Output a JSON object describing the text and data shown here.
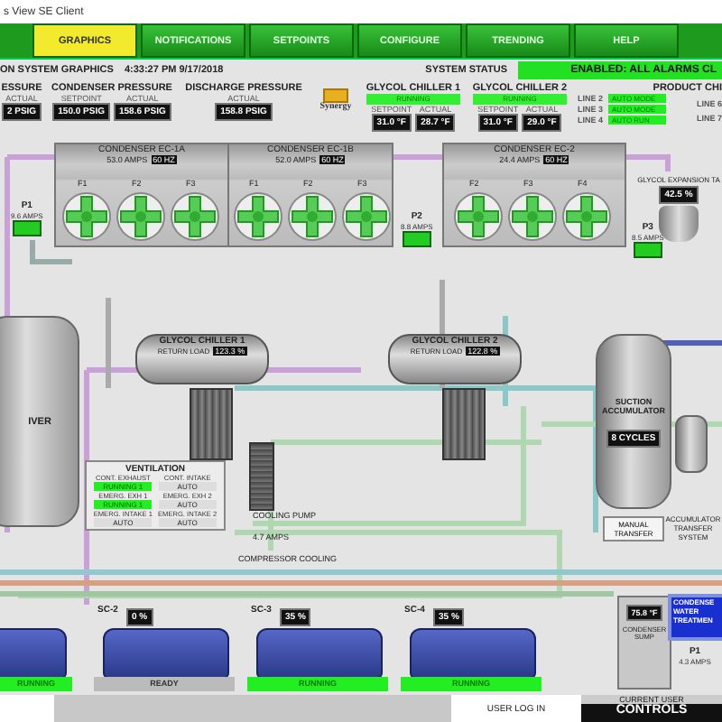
{
  "window": {
    "title": "s View SE Client"
  },
  "tabs": [
    {
      "label": "GRAPHICS",
      "selected": true
    },
    {
      "label": "NOTIFICATIONS",
      "selected": false
    },
    {
      "label": "SETPOINTS",
      "selected": false
    },
    {
      "label": "CONFIGURE",
      "selected": false
    },
    {
      "label": "TRENDING",
      "selected": false
    },
    {
      "label": "HELP",
      "selected": false
    }
  ],
  "header": {
    "title": "ON SYSTEM GRAPHICS",
    "datetime": "4:33:27 PM 9/17/2018",
    "status_label": "SYSTEM STATUS",
    "status": "ENABLED: ALL ALARMS CL"
  },
  "pressure_panels": [
    {
      "title": "ESSURE",
      "fields": [
        {
          "label": "ACTUAL",
          "value": "2 PSIG"
        }
      ]
    },
    {
      "title": "CONDENSER PRESSURE",
      "fields": [
        {
          "label": "SETPOINT",
          "value": "150.0 PSIG"
        },
        {
          "label": "ACTUAL",
          "value": "158.6 PSIG"
        }
      ]
    },
    {
      "title": "DISCHARGE PRESSURE",
      "fields": [
        {
          "label": "ACTUAL",
          "value": "158.8 PSIG"
        }
      ]
    }
  ],
  "logo": {
    "text": "Synergy"
  },
  "chiller_panels": [
    {
      "title": "GLYCOL CHILLER 1",
      "status": "RUNNING",
      "fields": [
        {
          "label": "SETPOINT",
          "value": "31.0 °F"
        },
        {
          "label": "ACTUAL",
          "value": "28.7 °F"
        }
      ]
    },
    {
      "title": "GLYCOL CHILLER 2",
      "status": "RUNNING",
      "fields": [
        {
          "label": "SETPOINT",
          "value": "31.0 °F"
        },
        {
          "label": "ACTUAL",
          "value": "29.0 °F"
        }
      ]
    }
  ],
  "product_chillers": {
    "title": "PRODUCT CHI",
    "lines": [
      {
        "label": "LINE 2",
        "mode": "AUTO MODE"
      },
      {
        "label": "LINE 3",
        "mode": "AUTO MODE"
      },
      {
        "label": "LINE 4",
        "mode": "AUTO RUN"
      }
    ],
    "more": [
      "LINE 6",
      "LINE 7"
    ]
  },
  "condensers": [
    {
      "name": "CONDENSER EC-1A",
      "amps": "53.0 AMPS",
      "freq": "60 HZ",
      "fans": [
        "F1",
        "F2",
        "F3"
      ]
    },
    {
      "name": "CONDENSER EC-1B",
      "amps": "52.0 AMPS",
      "freq": "60 HZ",
      "fans": [
        "F1",
        "F2",
        "F3"
      ]
    },
    {
      "name": "CONDENSER EC-2",
      "amps": "24.4 AMPS",
      "freq": "60 HZ",
      "fans": [
        "F2",
        "F3",
        "F4"
      ]
    }
  ],
  "pumps": [
    {
      "name": "P1",
      "amps": "9.6 AMPS"
    },
    {
      "name": "P2",
      "amps": "8.8 AMPS"
    },
    {
      "name": "P3",
      "amps": "8.5 AMPS"
    }
  ],
  "expansion_tank": {
    "label": "GLYCOL EXPANSION TA",
    "reading": "42.5 %"
  },
  "receiver": {
    "label": "IVER"
  },
  "glycol_chillers": [
    {
      "name": "GLYCOL CHILLER 1",
      "load_label": "RETURN LOAD",
      "load": "123.3 %"
    },
    {
      "name": "GLYCOL CHILLER 2",
      "load_label": "RETURN LOAD",
      "load": "122.8 %"
    }
  ],
  "ventilation": {
    "title": "VENTILATION",
    "items": [
      {
        "label": "CONT. EXHAUST",
        "state": "RUNNING 1",
        "running": true
      },
      {
        "label": "CONT. INTAKE",
        "state": "AUTO",
        "running": false
      },
      {
        "label": "EMERG. EXH 1",
        "state": "RUNNING 1",
        "running": true
      },
      {
        "label": "EMERG. EXH 2",
        "state": "AUTO",
        "running": false
      },
      {
        "label": "EMERG. INTAKE 1",
        "state": "AUTO",
        "running": false
      },
      {
        "label": "EMERG. INTAKE 2",
        "state": "AUTO",
        "running": false
      }
    ]
  },
  "accumulator": {
    "name": "SUCTION ACCUMULATOR",
    "cycles": "8 CYCLES"
  },
  "transfer": {
    "button": "MANUAL TRANSFER",
    "label": "ACCUMULATOR TRANSFER SYSTEM"
  },
  "cooling": {
    "pump": "COOLING PUMP",
    "amps": "4.7 AMPS",
    "label": "COMPRESSOR COOLING"
  },
  "compressors": [
    {
      "status": "RUNNING",
      "running": true
    },
    {
      "name": "SC-2",
      "capacity": "0 %",
      "status": "READY",
      "running": false
    },
    {
      "name": "SC-3",
      "capacity": "35 %",
      "status": "RUNNING",
      "running": true
    },
    {
      "name": "SC-4",
      "capacity": "35 %",
      "status": "RUNNING",
      "running": true
    }
  ],
  "sump": {
    "temp": "75.8 °F",
    "label": "CONDENSER SUMP",
    "pump": "P1",
    "amps": "4.3 AMPS"
  },
  "water_treatment": {
    "lines": [
      "CONDENSE",
      "WATER",
      "TREATMEN"
    ]
  },
  "footer": {
    "login": "USER LOG IN",
    "current_user_label": "CURRENT USER",
    "current_user": "CONTROLS"
  }
}
